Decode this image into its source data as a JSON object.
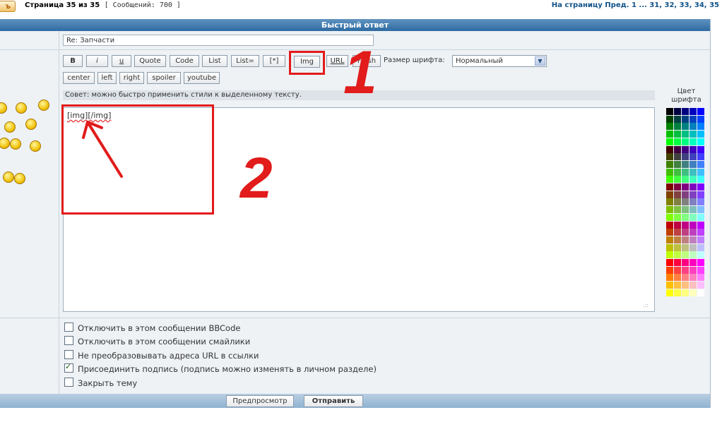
{
  "topbar": {
    "reply_label": "ъ",
    "page_info": "Страница 35 из 35",
    "post_count": "[ Сообщений: 700 ]",
    "pages_nav_prefix": "На страницу Пред.",
    "pages_nav_links": "1 ... 31, 32, 33, 34, 35"
  },
  "form": {
    "header_title": "Быстрый ответ",
    "subject_value": "Re: Запчасти",
    "toolbar": {
      "row1": [
        "B",
        "i",
        "u",
        "Quote",
        "Code",
        "List",
        "List=",
        "[*]",
        "Img",
        "URL",
        "Flash"
      ],
      "row2": [
        "center",
        "left",
        "right",
        "spoiler",
        "youtube"
      ],
      "font_size_label": "Размер шрифта:",
      "font_size_value": "Нормальный"
    },
    "hint": "Совет: можно быстро применить стили к выделенному тексту.",
    "message_value": "[img][/img]",
    "color_label": "Цвет шрифта",
    "options": [
      {
        "label": "Отключить в этом сообщении BBCode",
        "checked": false
      },
      {
        "label": "Отключить в этом сообщении смайлики",
        "checked": false
      },
      {
        "label": "Не преобразовывать адреса URL в ссылки",
        "checked": false
      },
      {
        "label": "Присоединить подпись (подпись можно изменять в личном разделе)",
        "checked": true
      },
      {
        "label": "Закрыть тему",
        "checked": false
      }
    ],
    "preview_label": "Предпросмотр",
    "submit_label": "Отправить"
  },
  "annotations": {
    "step1": "1",
    "step2": "2",
    "color": "#e21b1b"
  },
  "palette_rows": [
    [
      "#000000",
      "#000040",
      "#000080",
      "#0000bf",
      "#0000ff"
    ],
    [
      "#004000",
      "#004040",
      "#004080",
      "#0040bf",
      "#0040ff"
    ],
    [
      "#008000",
      "#008040",
      "#008080",
      "#0080bf",
      "#0080ff"
    ],
    [
      "#00bf00",
      "#00bf40",
      "#00bf80",
      "#00bfbf",
      "#00bfff"
    ],
    [
      "#00ff00",
      "#00ff40",
      "#00ff80",
      "#00ffbf",
      "#00ffff"
    ],
    [
      "#400000",
      "#400040",
      "#400080",
      "#4000bf",
      "#4000ff"
    ],
    [
      "#404000",
      "#404040",
      "#404080",
      "#4040bf",
      "#4040ff"
    ],
    [
      "#408000",
      "#408040",
      "#408080",
      "#4080bf",
      "#4080ff"
    ],
    [
      "#40bf00",
      "#40bf40",
      "#40bf80",
      "#40bfbf",
      "#40bfff"
    ],
    [
      "#40ff00",
      "#40ff40",
      "#40ff80",
      "#40ffbf",
      "#40ffff"
    ],
    [
      "#800000",
      "#800040",
      "#800080",
      "#8000bf",
      "#8000ff"
    ],
    [
      "#804000",
      "#804040",
      "#804080",
      "#8040bf",
      "#8040ff"
    ],
    [
      "#808000",
      "#808040",
      "#808080",
      "#8080bf",
      "#8080ff"
    ],
    [
      "#80bf00",
      "#80bf40",
      "#80bf80",
      "#80bfbf",
      "#80bfff"
    ],
    [
      "#80ff00",
      "#80ff40",
      "#80ff80",
      "#80ffbf",
      "#80ffff"
    ],
    [
      "#bf0000",
      "#bf0040",
      "#bf0080",
      "#bf00bf",
      "#bf00ff"
    ],
    [
      "#bf4000",
      "#bf4040",
      "#bf4080",
      "#bf40bf",
      "#bf40ff"
    ],
    [
      "#bf8000",
      "#bf8040",
      "#bf8080",
      "#bf80bf",
      "#bf80ff"
    ],
    [
      "#bfbf00",
      "#bfbf40",
      "#bfbf80",
      "#bfbfbf",
      "#bfbfff"
    ],
    [
      "#bfff00",
      "#bfff40",
      "#bfff80",
      "#bfffbf",
      "#bfffff"
    ],
    [
      "#ff0000",
      "#ff0040",
      "#ff0080",
      "#ff00bf",
      "#ff00ff"
    ],
    [
      "#ff4000",
      "#ff4040",
      "#ff4080",
      "#ff40bf",
      "#ff40ff"
    ],
    [
      "#ff8000",
      "#ff8040",
      "#ff8080",
      "#ff80bf",
      "#ff80ff"
    ],
    [
      "#ffbf00",
      "#ffbf40",
      "#ffbf80",
      "#ffbfbf",
      "#ffbfff"
    ],
    [
      "#ffff00",
      "#ffff40",
      "#ffff80",
      "#ffffbf",
      "#ffffff"
    ]
  ]
}
